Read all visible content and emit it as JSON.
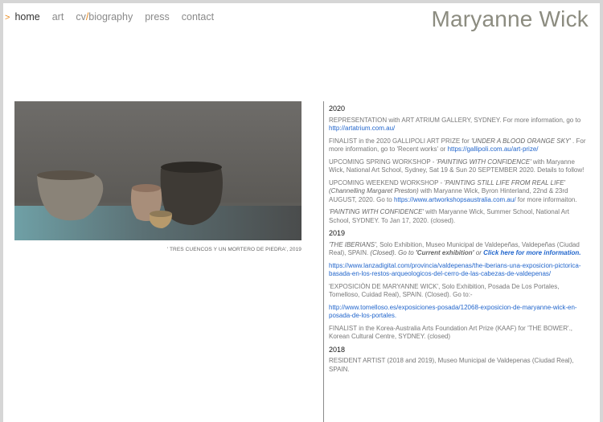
{
  "nav": {
    "arrow": ">",
    "items": [
      {
        "label": "home"
      },
      {
        "label": "art"
      },
      {
        "label_pre": "cv",
        "label_slash": "/",
        "label_post": "biography"
      },
      {
        "label": "press"
      },
      {
        "label": "contact"
      }
    ]
  },
  "brand": "Maryanne Wick",
  "artwork": {
    "caption": "' TRES CUENCOS Y UN MORTERO DE PIEDRA', 2019"
  },
  "news": {
    "y2020": "2020",
    "e1": {
      "text": "REPRESENTATION with ART ATRIUM GALLERY, SYDNEY. For more information, go to ",
      "link": "http://artatrium.com.au/"
    },
    "e2": {
      "a": "FINALIST in the 2020 GALLIPOLI ART PRIZE  for ",
      "b": "'UNDER A BLOOD ORANGE SKY'",
      "c": " . For more information, go to 'Recent works' or ",
      "link": "https://gallipoli.com.au/art-prize/"
    },
    "e3": {
      "a": "UPCOMING SPRING WORKSHOP - ",
      "b": "'PAINTING WITH CONFIDENCE'",
      "c": " with Maryanne Wick, National Art School, Sydney, Sat 19 & Sun 20 SEPTEMBER 2020. Details to follow!"
    },
    "e4": {
      "a": "UPCOMING WEEKEND WORKSHOP - ",
      "b": "'PAINTING STILL LIFE FROM REAL LIFE' (Channelling Margaret Preston)",
      "c": " with Maryanne Wick, Byron Hinterland, 22nd & 23rd AUGUST, 2020. Go to ",
      "link": "https://www.artworkshopsaustralia.com.au/",
      "d": " for more informaiton."
    },
    "e5": {
      "b": "'PAINTING WITH CONFIDENCE'",
      "c": " with Maryanne Wick, Summer School,  National Art School, SYDNEY. To Jan 17, 2020. (closed)."
    },
    "y2019": "2019",
    "e6": {
      "b": "'THE IBERIANS'",
      "c": ", Solo Exhibition, Museo Municipal de Valdepeñas, Valdepeñas (Ciudad Real), SPAIN. ",
      "d": "(Closed). Go to ",
      "e": "'Current exhibition'",
      "f": " or ",
      "link": "Click here for more information."
    },
    "e7": {
      "link": "https://www.lanzadigital.com/provincia/valdepenas/the-iberians-una-exposicion-pictorica-basada-en-los-restos-arqueologicos-del-cerro-de-las-cabezas-de-valdepenas/"
    },
    "e8": {
      "text": "'EXPOSICIÒN DE MARYANNE WICK', Solo Exhibition, Posada De Los Portales, Tomelloso, Cuidad Real), SPAIN. (Closed). Go to:-"
    },
    "e9": {
      "link": "http://www.tomelloso.es/exposiciones-posada/12068-exposicion-de-maryanne-wick-en-posada-de-los-portales."
    },
    "e10": {
      "text": "FINALIST in the Korea-Australia Arts Foundation Art Prize (KAAF) for 'THE BOWER'., Korean Cultural Centre, SYDNEY. (closed)"
    },
    "y2018": "2018",
    "e11": {
      "text": "RESIDENT ARTIST (2018 and 2019), Museo Municipal de Valdepenas (Ciudad Real), SPAIN."
    }
  },
  "colors": {
    "accent": "#e8891c",
    "link": "#2266cc",
    "brand": "#8c8c80"
  }
}
